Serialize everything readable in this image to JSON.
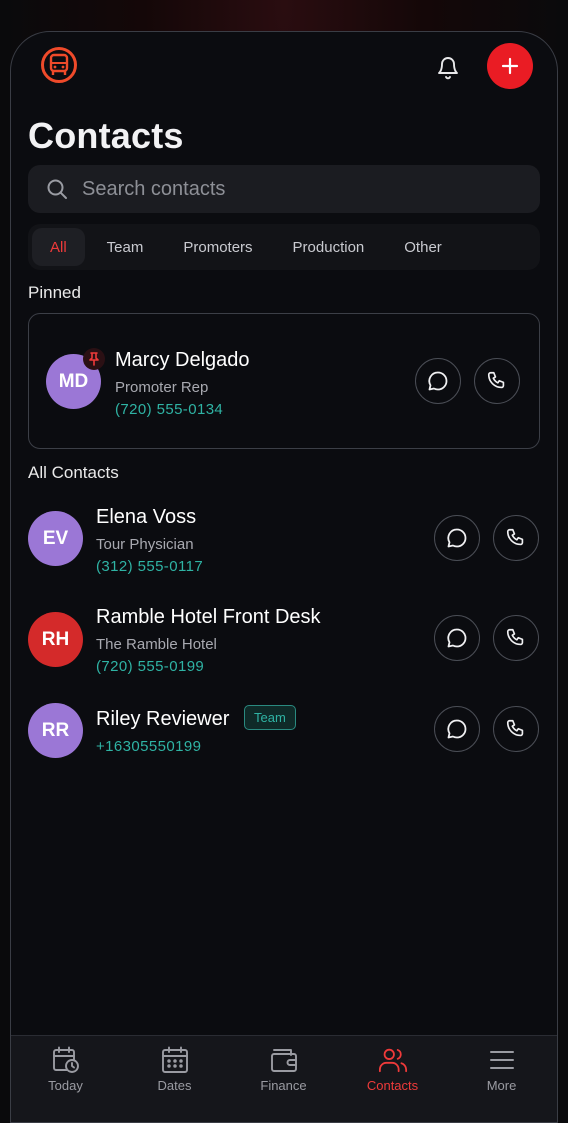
{
  "header": {
    "title": "Contacts",
    "add_label": "+"
  },
  "search": {
    "placeholder": "Search contacts",
    "value": ""
  },
  "filters": [
    {
      "label": "All",
      "active": true
    },
    {
      "label": "Team",
      "active": false
    },
    {
      "label": "Promoters",
      "active": false
    },
    {
      "label": "Production",
      "active": false
    },
    {
      "label": "Other",
      "active": false
    }
  ],
  "sections": {
    "pinned": "Pinned",
    "all": "All Contacts"
  },
  "pinned": [
    {
      "initials": "MD",
      "name": "Marcy Delgado",
      "role": "Promoter Rep",
      "phone": "(720) 555-0134",
      "avatar_color": "#9b77d6"
    }
  ],
  "contacts": [
    {
      "initials": "EV",
      "name": "Elena Voss",
      "role": "Tour Physician",
      "phone": "(312) 555-0117",
      "avatar_color": "#9b77d6"
    },
    {
      "initials": "RH",
      "name": "Ramble Hotel Front Desk",
      "role": "The Ramble Hotel",
      "phone": "(720) 555-0199",
      "avatar_color": "#d42a2a"
    },
    {
      "initials": "RR",
      "name": "Riley Reviewer",
      "tag": "Team",
      "phone": "+16305550199",
      "avatar_color": "#9b77d6"
    }
  ],
  "tabbar": [
    {
      "label": "Today",
      "icon": "calendar-clock-icon",
      "active": false
    },
    {
      "label": "Dates",
      "icon": "calendar-icon",
      "active": false
    },
    {
      "label": "Finance",
      "icon": "wallet-icon",
      "active": false
    },
    {
      "label": "Contacts",
      "icon": "users-icon",
      "active": true
    },
    {
      "label": "More",
      "icon": "menu-icon",
      "active": false
    }
  ],
  "colors": {
    "accent": "#ea1c24",
    "teal": "#2fb3a4",
    "purple": "#9b77d6"
  }
}
